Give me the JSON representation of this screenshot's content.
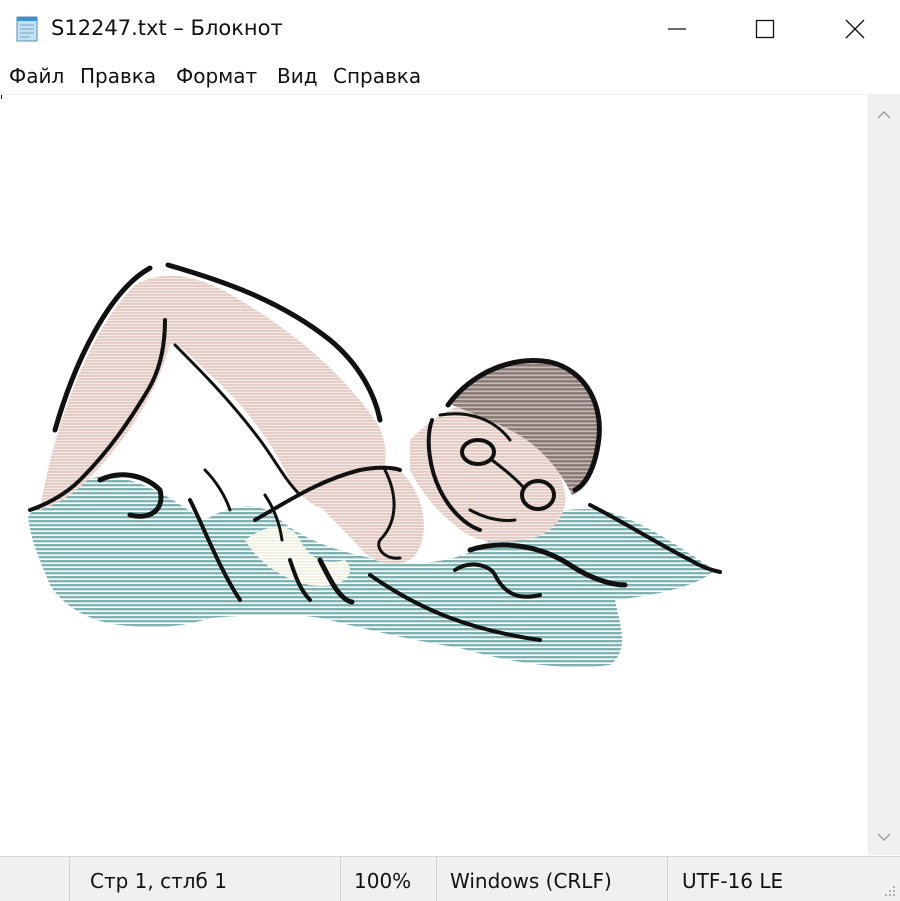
{
  "window": {
    "title": "S12247.txt – Блокнот",
    "icon": "notepad-icon",
    "controls": [
      "minimize-icon",
      "maximize-icon",
      "close-icon"
    ]
  },
  "menu": {
    "file": "Файл",
    "edit": "Правка",
    "format": "Формат",
    "view": "Вид",
    "help": "Справка"
  },
  "document": {
    "image": "swimmer-clipart",
    "colors": {
      "water": "#7fb3b3",
      "skin": "#e6d2cc",
      "cap": "#8c7d78",
      "outline": "#111111"
    }
  },
  "scrollbar": {
    "up_icon": "chevron-up-icon",
    "down_icon": "chevron-down-icon"
  },
  "status": {
    "position": "Стр 1, стлб 1",
    "zoom": "100%",
    "line_endings": "Windows (CRLF)",
    "encoding": "UTF-16 LE"
  }
}
